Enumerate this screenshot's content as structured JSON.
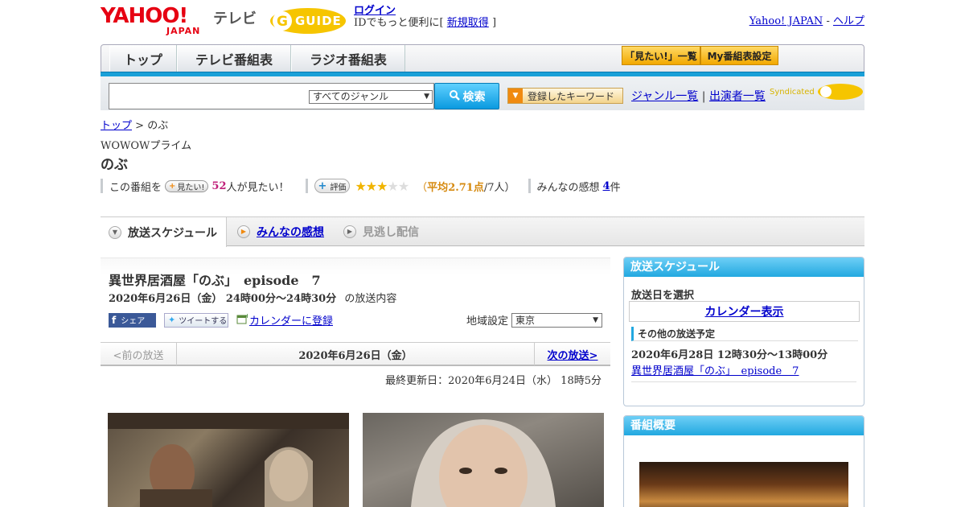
{
  "header": {
    "logo_yahoo": "YAHOO!",
    "logo_japan": "JAPAN",
    "logo_tv": "テレビ",
    "gguide_label": "GUIDE",
    "login_link": "ログイン",
    "login_prefix": "IDでもっと便利に[",
    "signup_link": "新規取得",
    "login_suffix": "]",
    "util_yahoo": "Yahoo! JAPAN",
    "util_sep": " - ",
    "util_help": "ヘルプ"
  },
  "nav": {
    "tabs": [
      {
        "label": "トップ"
      },
      {
        "label": "テレビ番組表"
      },
      {
        "label": "ラジオ番組表"
      }
    ],
    "btn_mitai_list": "「見たい!」一覧",
    "btn_my_settings": "My番組表設定"
  },
  "search": {
    "genre_selected": "すべてのジャンル",
    "search_button": "検索",
    "keyword_button": "登録したキーワード",
    "genre_list_link": "ジャンル一覧",
    "link_sep": " | ",
    "performers_link": "出演者一覧",
    "syndicated": "Syndicated"
  },
  "breadcrumb": {
    "top": "トップ",
    "sep": " > ",
    "current": "のぶ"
  },
  "program": {
    "station": "WOWOWプライム",
    "title": "のぶ",
    "stats_prefix": "この番組を",
    "mitai_chip": "見たい!",
    "mitai_count": "52",
    "mitai_suffix": "人が見たい！",
    "hyoka_chip": "評価",
    "rating_open": "（",
    "rating_avg_label": "平均",
    "rating_avg": "2.71点",
    "rating_people": "/7人）",
    "impressions_prefix": "みんなの感想",
    "impressions_count": "4",
    "impressions_suffix": "件"
  },
  "tabs": {
    "schedule": "放送スケジュール",
    "impressions": "みんなの感想",
    "missed": "見逃し配信"
  },
  "episode": {
    "title": "異世界居酒屋「のぶ」　episode　7",
    "date_bold": "2020年6月26日（金）  24時00分～24時30分",
    "date_suffix": "の放送内容",
    "share_fb": "シェア",
    "share_tw": "ツイートする",
    "calendar_link": "カレンダーに登録",
    "region_label": "地域設定",
    "region_selected": "東京"
  },
  "pager": {
    "prev": "<前の放送",
    "date": "2020年6月26日（金）",
    "next": "次の放送>"
  },
  "updated": "最終更新日：2020年6月24日（水） 18時5分",
  "sidebar": {
    "schedule_head": "放送スケジュール",
    "select_date": "放送日を選択",
    "calendar_btn": "カレンダー表示",
    "other_label": "その他の放送予定",
    "other_time": "2020年6月28日  12時30分～13時00分",
    "other_link": "異世界居酒屋「のぶ」　episode　7",
    "overview_head": "番組概要"
  }
}
